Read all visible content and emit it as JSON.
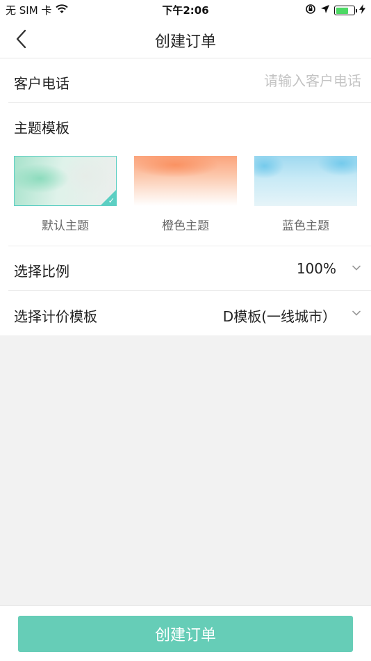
{
  "status_bar": {
    "carrier": "无 SIM 卡",
    "time": "下午2:06",
    "battery_level": 0.7
  },
  "nav": {
    "title": "创建订单",
    "back_icon": "chevron-left-icon"
  },
  "form": {
    "customer_phone": {
      "label": "客户电话",
      "placeholder": "请输入客户电话",
      "value": ""
    },
    "theme": {
      "label": "主题模板",
      "options": [
        {
          "name": "默认主题",
          "selected": true
        },
        {
          "name": "橙色主题",
          "selected": false
        },
        {
          "name": "蓝色主题",
          "selected": false
        }
      ],
      "check_glyph": "✓"
    },
    "ratio": {
      "label": "选择比例",
      "value": "100%"
    },
    "pricing_template": {
      "label": "选择计价模板",
      "value": "D模板(一线城市）"
    }
  },
  "footer": {
    "submit_label": "创建订单"
  },
  "colors": {
    "accent": "#66cdb7",
    "selected_border": "#5ccfc3",
    "background": "#f2f2f2"
  }
}
